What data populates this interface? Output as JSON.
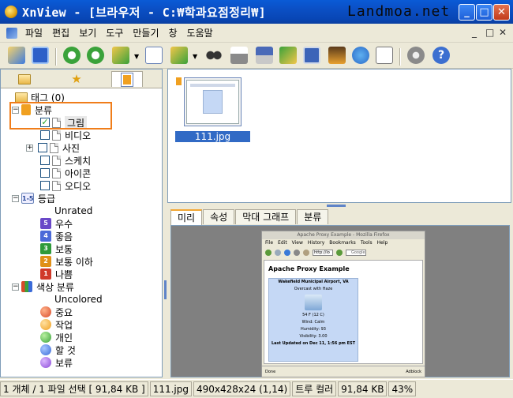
{
  "window": {
    "title": "XnView - [브라우저 - C:₩학과요점정리₩]",
    "watermark": "Landmoa.net",
    "minimize": "_",
    "maximize": "□",
    "close": "✕"
  },
  "menubar": {
    "items": [
      "파일",
      "편집",
      "보기",
      "도구",
      "만들기",
      "창",
      "도움말"
    ],
    "mdi_controls": [
      "_",
      "□",
      "✕"
    ]
  },
  "toolbar": {
    "icons": [
      "open-browser-icon",
      "fullscreen-icon",
      "rotate-left-icon",
      "rotate-right-icon",
      "copy-move-icon",
      "properties-icon",
      "export-icon",
      "find-icon",
      "print-icon",
      "scan-icon",
      "slideshow-icon",
      "capture-icon",
      "wallpaper-icon",
      "web-icon",
      "contact-sheet-icon",
      "settings-icon",
      "help-icon"
    ]
  },
  "left_panel": {
    "tree": [
      {
        "label": "태그 (0)"
      },
      {
        "label": "분류"
      },
      {
        "label": "그림"
      },
      {
        "label": "비디오"
      },
      {
        "label": "사진"
      },
      {
        "label": "스케치"
      },
      {
        "label": "아이콘"
      },
      {
        "label": "오디오"
      },
      {
        "label": "등급"
      },
      {
        "label": "Unrated"
      },
      {
        "label": "우수",
        "badge": "5"
      },
      {
        "label": "좋음",
        "badge": "4"
      },
      {
        "label": "보통",
        "badge": "3"
      },
      {
        "label": "보통 이하",
        "badge": "2"
      },
      {
        "label": "나쁨",
        "badge": "1"
      },
      {
        "label": "색상 분류"
      },
      {
        "label": "Uncolored"
      },
      {
        "label": "중요"
      },
      {
        "label": "작업"
      },
      {
        "label": "개인"
      },
      {
        "label": "할 것"
      },
      {
        "label": "보류"
      }
    ]
  },
  "browser": {
    "thumbnail_label": "111.jpg"
  },
  "preview": {
    "tabs": [
      "미리",
      "속성",
      "막대 그래프",
      "분류"
    ],
    "firefox": {
      "title": "Apache Proxy Example - Mozilla Firefox",
      "menu": [
        "File",
        "Edit",
        "View",
        "History",
        "Bookmarks",
        "Tools",
        "Help"
      ],
      "url": "http://lo",
      "search": "Google",
      "heading": "Apache Proxy Example",
      "card_title": "Wakefield Municipal Airport, VA",
      "card_sub": "Overcast with Haze",
      "temp": "54 F (12 C)",
      "wind": "Wind: Calm",
      "humidity": "Humidity: 93",
      "visibility": "Visibility: 3.00",
      "updated": "Last Updated on Dec 11, 1:56 pm EST",
      "status_left": "Done",
      "status_right": "Adblock"
    }
  },
  "statusbar": {
    "items": [
      "1 개체 / 1 파일 선택  [ 91,84 KB ]",
      "111.jpg",
      "490x428x24 (1,14)",
      "트루 컬러",
      "91,84 KB",
      "43%"
    ]
  },
  "colors": {
    "titlebar": "#0a5bd6",
    "selection": "#316ac5",
    "highlight_box": "#f07d1a",
    "ratings": [
      "#6a48c8",
      "#4b6ad8",
      "#2e9a3a",
      "#e09018",
      "#d03a2a"
    ],
    "color_labels": [
      "#d84a2a",
      "#f0a020",
      "#3aa23a",
      "#3a6ad8",
      "#8a4ad8"
    ]
  }
}
